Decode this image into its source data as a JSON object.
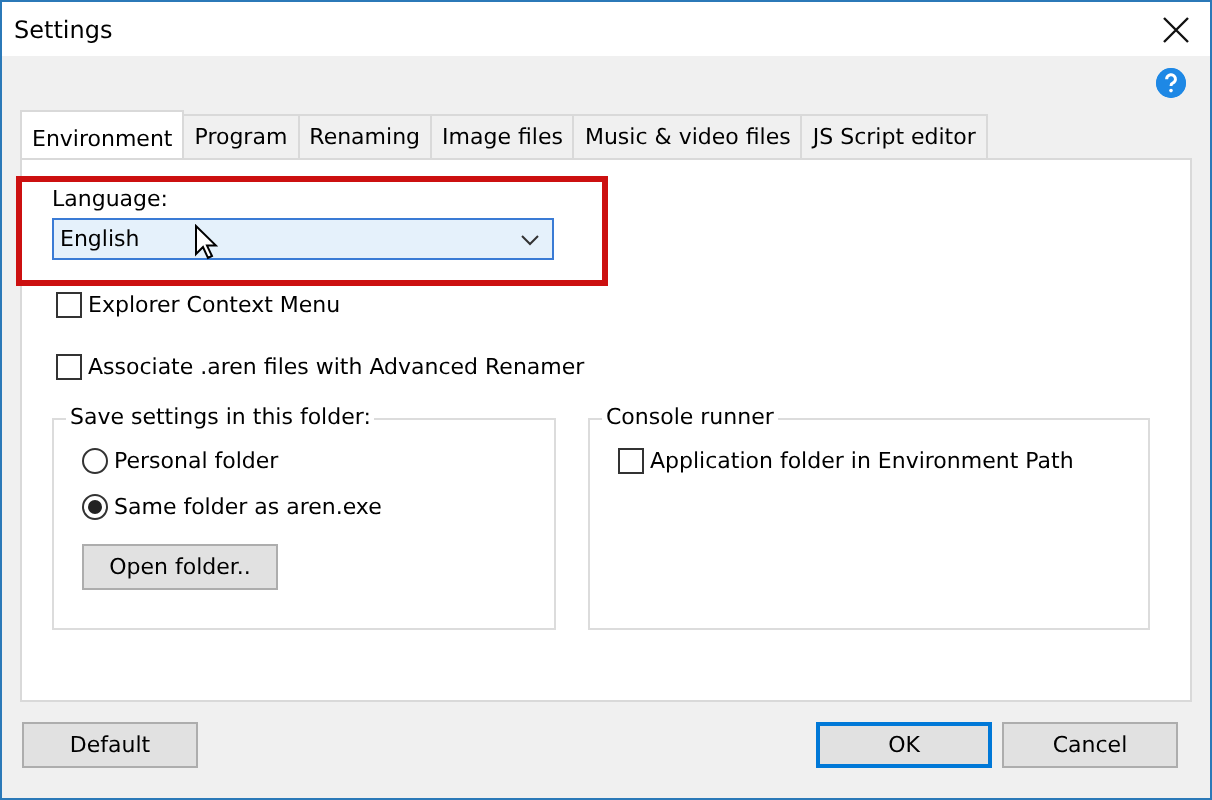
{
  "window": {
    "title": "Settings"
  },
  "tabs": [
    {
      "label": "Environment",
      "selected": true
    },
    {
      "label": "Program",
      "selected": false
    },
    {
      "label": "Renaming",
      "selected": false
    },
    {
      "label": "Image files",
      "selected": false
    },
    {
      "label": "Music & video files",
      "selected": false
    },
    {
      "label": "JS Script editor",
      "selected": false
    }
  ],
  "language": {
    "label": "Language:",
    "value": "English"
  },
  "checkboxes": [
    {
      "label": "Explorer Context Menu",
      "checked": false
    },
    {
      "label": "Associate .aren files with Advanced Renamer",
      "checked": false
    }
  ],
  "save_group": {
    "title": "Save settings in this folder:",
    "options": [
      {
        "label": "Personal folder",
        "selected": false
      },
      {
        "label": "Same folder as aren.exe",
        "selected": true
      }
    ],
    "button": "Open folder.."
  },
  "console_group": {
    "title": "Console runner",
    "checkbox": {
      "label": "Application folder in Environment Path",
      "checked": false
    }
  },
  "buttons": [
    {
      "label": "Default",
      "kind": "plain"
    },
    {
      "label": "OK",
      "kind": "default"
    },
    {
      "label": "Cancel",
      "kind": "plain"
    }
  ]
}
